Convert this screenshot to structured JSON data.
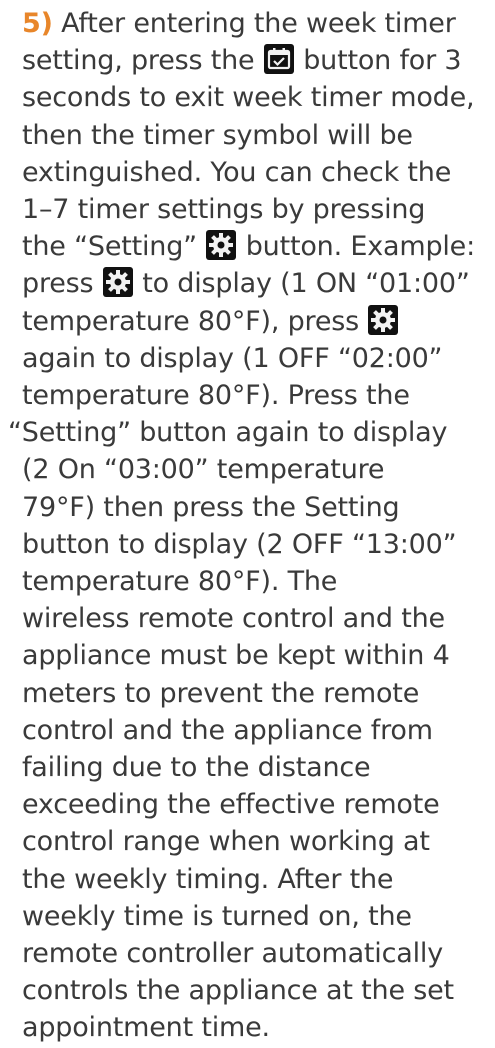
{
  "step": {
    "number": "5)",
    "lines": {
      "l1": "After entering the week timer",
      "l2a": "setting, press the",
      "l2b": "button for 3",
      "l3": "seconds to exit week timer mode,",
      "l4": "then the timer symbol will be",
      "l5": "extinguished. You can check the",
      "l6": "1–7 timer settings by pressing",
      "l7a": "the “Setting”",
      "l7b": "button. Example:",
      "l8a": "press",
      "l8b": "to display (1 ON “01:00”",
      "l9a": "temperature 80°F), press",
      "l10": "again to display (1 OFF “02:00”",
      "l11": "temperature 80°F). Press the",
      "l12": "“Setting” button again to display",
      "l13": "(2 On “03:00” temperature",
      "l14": "79°F) then press the Setting",
      "l15": "button to display (2 OFF “13:00”",
      "l16": "temperature 80°F). The",
      "l17": "wireless remote control and the",
      "l18": "appliance must be kept within 4",
      "l19": "meters to prevent the remote",
      "l20": "control and the appliance from",
      "l21": "failing due to the distance",
      "l22": "exceeding the effective remote",
      "l23": "control range when working at",
      "l24": "the weekly timing. After the",
      "l25": "weekly time is turned on, the",
      "l26": "remote controller automatically",
      "l27": "controls the appliance at the set",
      "l28": "appointment time."
    }
  },
  "icons": {
    "week_timer": "calendar-icon",
    "setting": "gear-icon"
  },
  "colors": {
    "accent": "#e8862a",
    "text": "#3a3a3a",
    "icon_bg": "#111111"
  }
}
